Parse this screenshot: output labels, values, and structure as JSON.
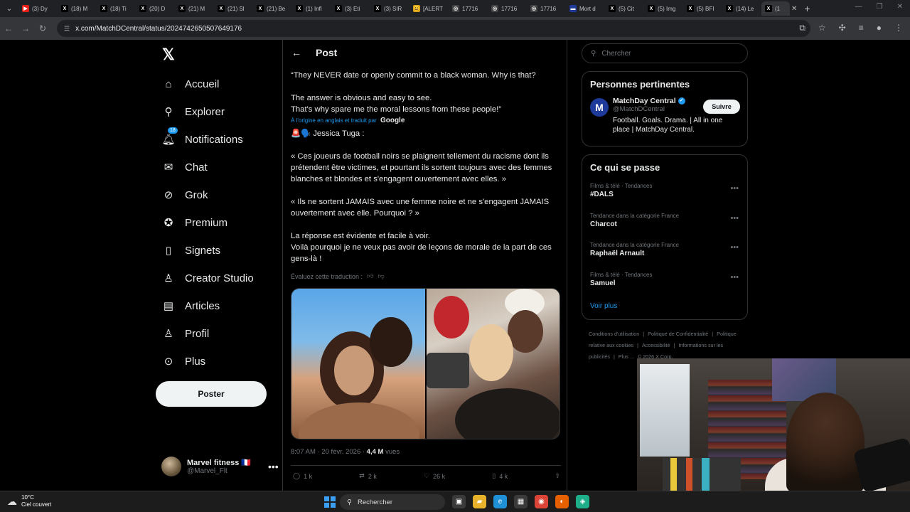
{
  "browser": {
    "tabs": [
      {
        "label": "(3) Dy",
        "color": "#e62117",
        "glyph": "▶"
      },
      {
        "label": "(18) M",
        "color": "#000000",
        "glyph": "X"
      },
      {
        "label": "(18) Ti",
        "color": "#000000",
        "glyph": "X"
      },
      {
        "label": "(20) D",
        "color": "#000000",
        "glyph": "X"
      },
      {
        "label": "(21) M",
        "color": "#000000",
        "glyph": "X"
      },
      {
        "label": "(21) Sl",
        "color": "#000000",
        "glyph": "X"
      },
      {
        "label": "(21) Be",
        "color": "#000000",
        "glyph": "X"
      },
      {
        "label": "(1) Infl",
        "color": "#000000",
        "glyph": "X"
      },
      {
        "label": "(3) Eti",
        "color": "#000000",
        "glyph": "X"
      },
      {
        "label": "(3) SIR",
        "color": "#000000",
        "glyph": "X"
      },
      {
        "label": "[ALERT",
        "color": "#d9a21b",
        "glyph": "😀"
      },
      {
        "label": "17716",
        "color": "#444444",
        "glyph": "◎"
      },
      {
        "label": "17716",
        "color": "#444444",
        "glyph": "◎"
      },
      {
        "label": "17716",
        "color": "#444444",
        "glyph": "◎"
      },
      {
        "label": "Mort d",
        "color": "#1e3b9c",
        "glyph": "▬"
      },
      {
        "label": "(5) Cit",
        "color": "#000000",
        "glyph": "X"
      },
      {
        "label": "(5) Img",
        "color": "#000000",
        "glyph": "X"
      },
      {
        "label": "(5) BFI",
        "color": "#000000",
        "glyph": "X"
      },
      {
        "label": "(14) Le",
        "color": "#000000",
        "glyph": "X"
      }
    ],
    "active_tab": {
      "label": "(1",
      "glyph": "X"
    },
    "url": "x.com/MatchDCentral/status/2024742650507649176"
  },
  "nav": {
    "logo": "𝕏",
    "items": [
      {
        "label": "Accueil",
        "icon": "home-icon",
        "glyph": "⌂"
      },
      {
        "label": "Explorer",
        "icon": "search-icon",
        "glyph": "⚲"
      },
      {
        "label": "Notifications",
        "icon": "bell-icon",
        "glyph": "🔔︎",
        "badge": "18"
      },
      {
        "label": "Chat",
        "icon": "mail-icon",
        "glyph": "✉"
      },
      {
        "label": "Grok",
        "icon": "grok-icon",
        "glyph": "⊘"
      },
      {
        "label": "Premium",
        "icon": "verified-icon",
        "glyph": "✪"
      },
      {
        "label": "Signets",
        "icon": "bookmark-icon",
        "glyph": "▯"
      },
      {
        "label": "Creator Studio",
        "icon": "flask-icon",
        "glyph": "♙"
      },
      {
        "label": "Articles",
        "icon": "article-icon",
        "glyph": "▤"
      },
      {
        "label": "Profil",
        "icon": "person-icon",
        "glyph": "♙"
      },
      {
        "label": "Plus",
        "icon": "more-icon",
        "glyph": "⊙"
      }
    ],
    "post_button": "Poster",
    "account": {
      "name": "Marvel fitness 🇫🇷",
      "handle": "@Marvel_Flt"
    }
  },
  "post": {
    "header_title": "Post",
    "english_lines": [
      "“They NEVER date or openly commit to a black woman. Why is that?",
      "",
      "The answer is obvious and easy to see.",
      "That's why spare me the moral lessons from these people!”"
    ],
    "translation_note": "À l'origine en anglais et traduit par",
    "translation_brand": "Google",
    "author_line": "🚨🗣️ Jessica Tuga :",
    "french_p1": "« Ces joueurs de football noirs se plaignent tellement du racisme dont ils prétendent être victimes, et pourtant ils sortent toujours avec des femmes blanches et blondes et s'engagent ouvertement avec elles. »",
    "french_p2": "« Ils ne sortent JAMAIS avec une femme noire et ne s'engagent JAMAIS ouvertement avec elle. Pourquoi ? »",
    "french_p3a": "La réponse est évidente et facile à voir.",
    "french_p3b": "Voilà pourquoi je ne veux pas avoir de leçons de morale de la part de ces gens-là !",
    "evaluate": "Évaluez cette traduction :",
    "time": "8:07 AM · 20 févr. 2026 · ",
    "views_count": "4,4 M",
    "views_label": " vues",
    "actions": {
      "replies": "1 k",
      "reposts": "2 k",
      "likes": "26 k",
      "bookmarks": "4 k"
    }
  },
  "sidebar": {
    "search_placeholder": "Chercher",
    "relevant_title": "Personnes pertinentes",
    "relevant": {
      "name": "MatchDay Central",
      "handle": "@MatchDCentral",
      "bio": "Football. Goals. Drama. | All in one place | MatchDay Central.",
      "follow": "Suivre",
      "logo_letter": "M"
    },
    "trends_title": "Ce qui se passe",
    "trends": [
      {
        "category": "Films & télé · Tendances",
        "name": "#DALS"
      },
      {
        "category": "Tendance dans la catégorie France",
        "name": "Charcot"
      },
      {
        "category": "Tendance dans la catégorie France",
        "name": "Raphaël Arnault"
      },
      {
        "category": "Films & télé · Tendances",
        "name": "Samuel"
      }
    ],
    "see_more": "Voir plus",
    "footer": [
      "Conditions d'utilisation",
      "|",
      "Politique de Confidentialité",
      "|",
      "Politique relative aux cookies",
      "|",
      "Accessibilité",
      "|",
      "Informations sur les publicités",
      "|",
      "Plus ...",
      "© 2026 X Corp."
    ]
  },
  "taskbar": {
    "temp": "10°C",
    "weather": "Ciel couvert",
    "search": "Rechercher",
    "apps": [
      {
        "icon": "task-view-icon",
        "color": "#3a3a3a",
        "glyph": "▣"
      },
      {
        "icon": "file-explorer-icon",
        "color": "#e8b32a",
        "glyph": "▰"
      },
      {
        "icon": "edge-icon",
        "color": "#1f8fd6",
        "glyph": "e"
      },
      {
        "icon": "store-icon",
        "color": "#3a3a3a",
        "glyph": "▦"
      },
      {
        "icon": "chrome-icon",
        "color": "#db4437",
        "glyph": "◉"
      },
      {
        "icon": "firefox-icon",
        "color": "#e66000",
        "glyph": "◐"
      },
      {
        "icon": "app-icon",
        "color": "#1fae8a",
        "glyph": "◈"
      }
    ]
  }
}
